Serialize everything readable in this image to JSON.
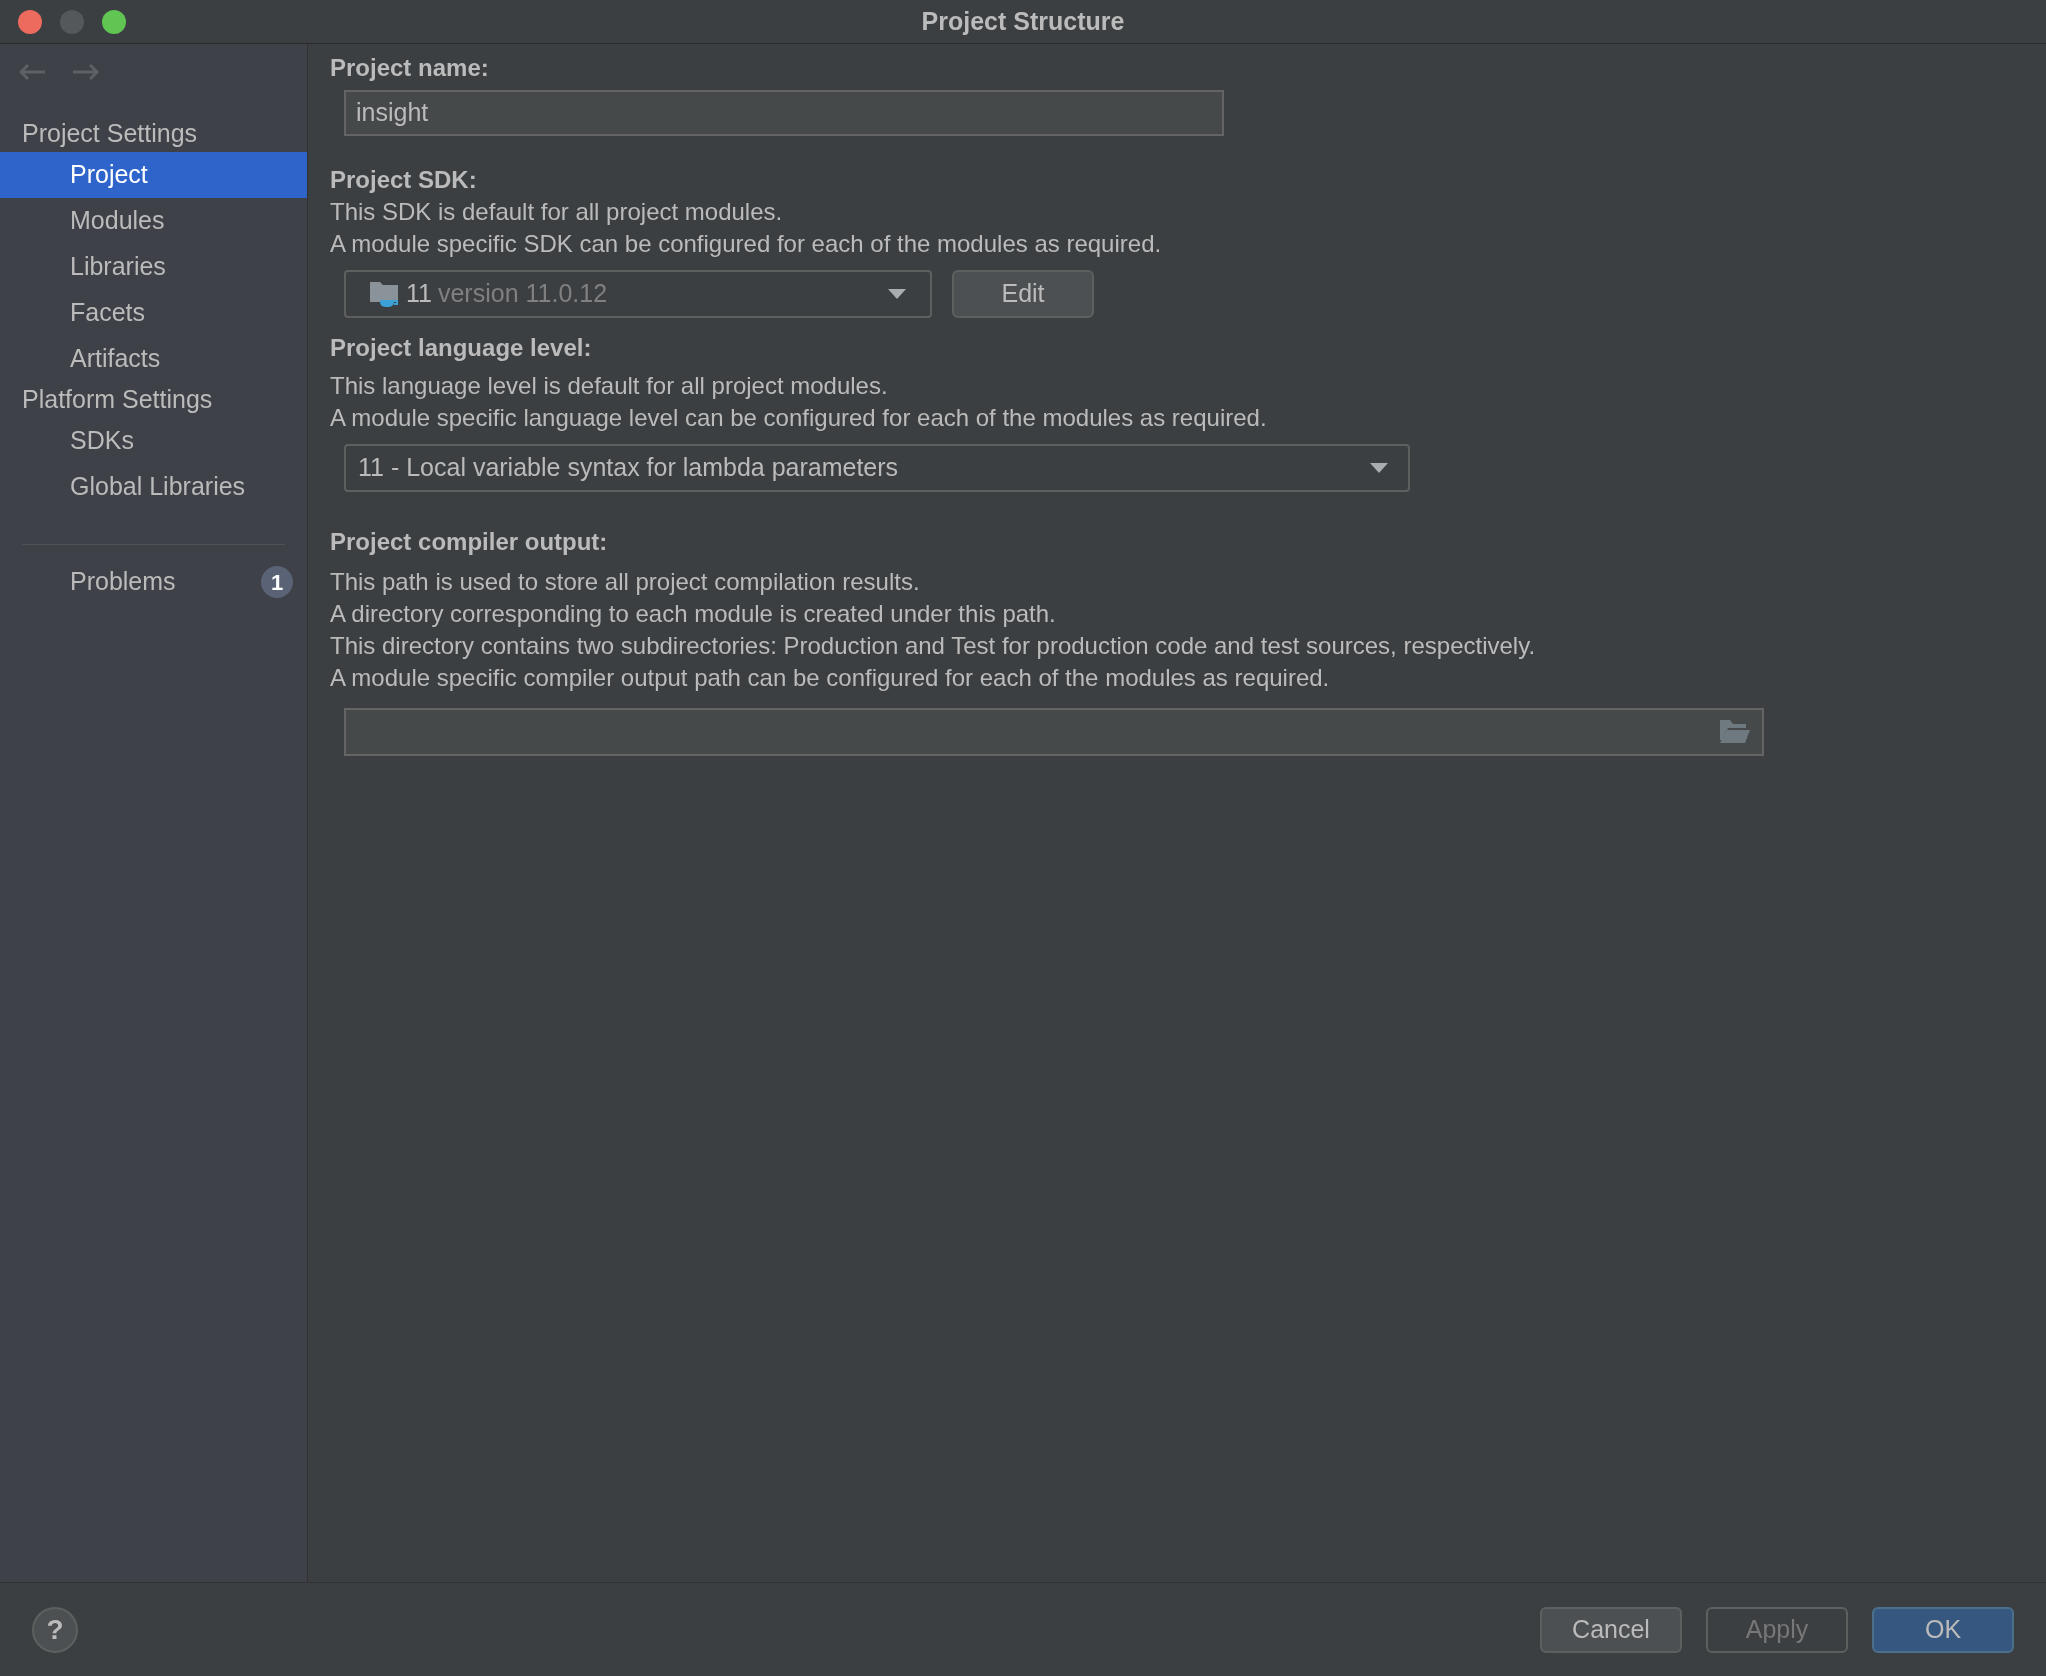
{
  "window": {
    "title": "Project Structure"
  },
  "sidebar": {
    "sections": [
      {
        "title": "Project Settings",
        "items": [
          {
            "label": "Project",
            "selected": true
          },
          {
            "label": "Modules",
            "selected": false
          },
          {
            "label": "Libraries",
            "selected": false
          },
          {
            "label": "Facets",
            "selected": false
          },
          {
            "label": "Artifacts",
            "selected": false
          }
        ]
      },
      {
        "title": "Platform Settings",
        "items": [
          {
            "label": "SDKs",
            "selected": false
          },
          {
            "label": "Global Libraries",
            "selected": false
          }
        ]
      }
    ],
    "problems": {
      "label": "Problems",
      "count": "1",
      "selected": false
    }
  },
  "project_name": {
    "label": "Project name:",
    "value": "insight"
  },
  "project_sdk": {
    "label": "Project SDK:",
    "description": [
      "This SDK is default for all project modules.",
      "A module specific SDK can be configured for each of the modules as required."
    ],
    "dropdown": {
      "value": "11",
      "detail": "version 11.0.12"
    },
    "edit_button": "Edit"
  },
  "language_level": {
    "label": "Project language level:",
    "description": [
      "This language level is default for all project modules.",
      "A module specific language level can be configured for each of the modules as required."
    ],
    "dropdown": {
      "value": "11 - Local variable syntax for lambda parameters"
    }
  },
  "compiler_output": {
    "label": "Project compiler output:",
    "description": [
      "This path is used to store all project compilation results.",
      "A directory corresponding to each module is created under this path.",
      "This directory contains two subdirectories: Production and Test for production code and test sources, respectively.",
      "A module specific compiler output path can be configured for each of the modules as required."
    ]
  },
  "footer": {
    "help": "?",
    "buttons": [
      {
        "label": "Cancel",
        "kind": "default"
      },
      {
        "label": "Apply",
        "kind": "disabled"
      },
      {
        "label": "OK",
        "kind": "primary"
      }
    ]
  }
}
